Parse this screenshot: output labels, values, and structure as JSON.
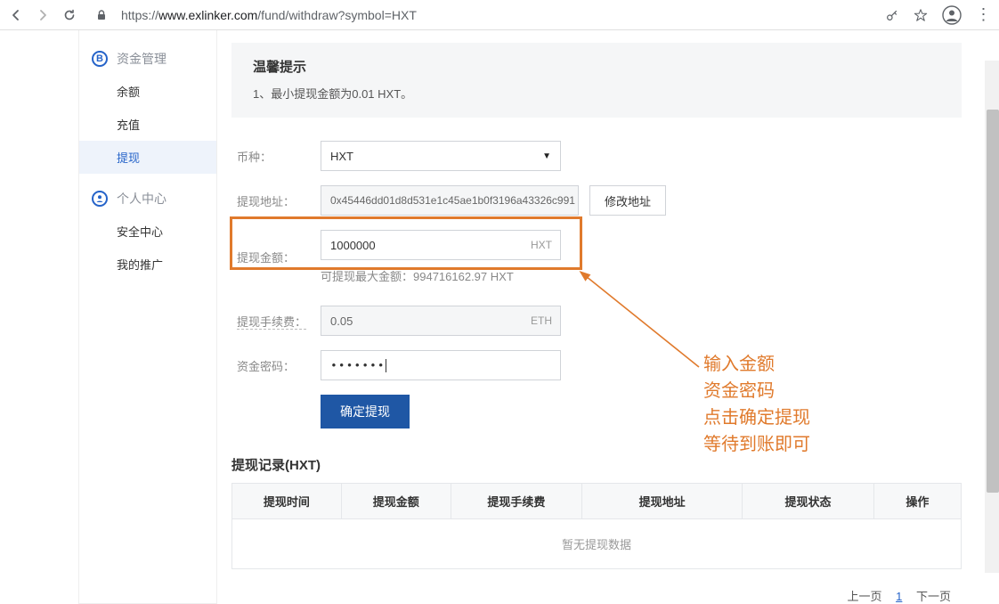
{
  "browser": {
    "scheme": "https://",
    "domain": "www.exlinker.com",
    "path": "/fund/withdraw?symbol=HXT"
  },
  "sidebar": {
    "section1_title": "资金管理",
    "section1_icon": "B",
    "items1": [
      "余额",
      "充值",
      "提现"
    ],
    "section2_title": "个人中心",
    "items2": [
      "安全中心",
      "我的推广"
    ]
  },
  "tip": {
    "title": "温馨提示",
    "text": "1、最小提现金额为0.01 HXT。"
  },
  "form": {
    "currency_label": "币种：",
    "currency_value": "HXT",
    "address_label": "提现地址：",
    "address_value": "0x45446dd01d8d531e1c45ae1b0f3196a43326c991",
    "modify_address_btn": "修改地址",
    "amount_label": "提现金额：",
    "amount_value": "1000000",
    "amount_suffix": "HXT",
    "amount_hint": "可提现最大金额：994716162.97 HXT",
    "fee_label": "提现手续费：",
    "fee_value": "0.05",
    "fee_suffix": "ETH",
    "password_label": "资金密码：",
    "password_masked": "•••••••",
    "submit_btn": "确定提现"
  },
  "annotation": {
    "lines": [
      "输入金额",
      "资金密码",
      "点击确定提现",
      "等待到账即可"
    ]
  },
  "records": {
    "title": "提现记录(HXT)",
    "cols": [
      "提现时间",
      "提现金额",
      "提现手续费",
      "提现地址",
      "提现状态",
      "操作"
    ],
    "empty": "暂无提现数据"
  },
  "pager": {
    "prev": "上一页",
    "current": "1",
    "next": "下一页"
  }
}
